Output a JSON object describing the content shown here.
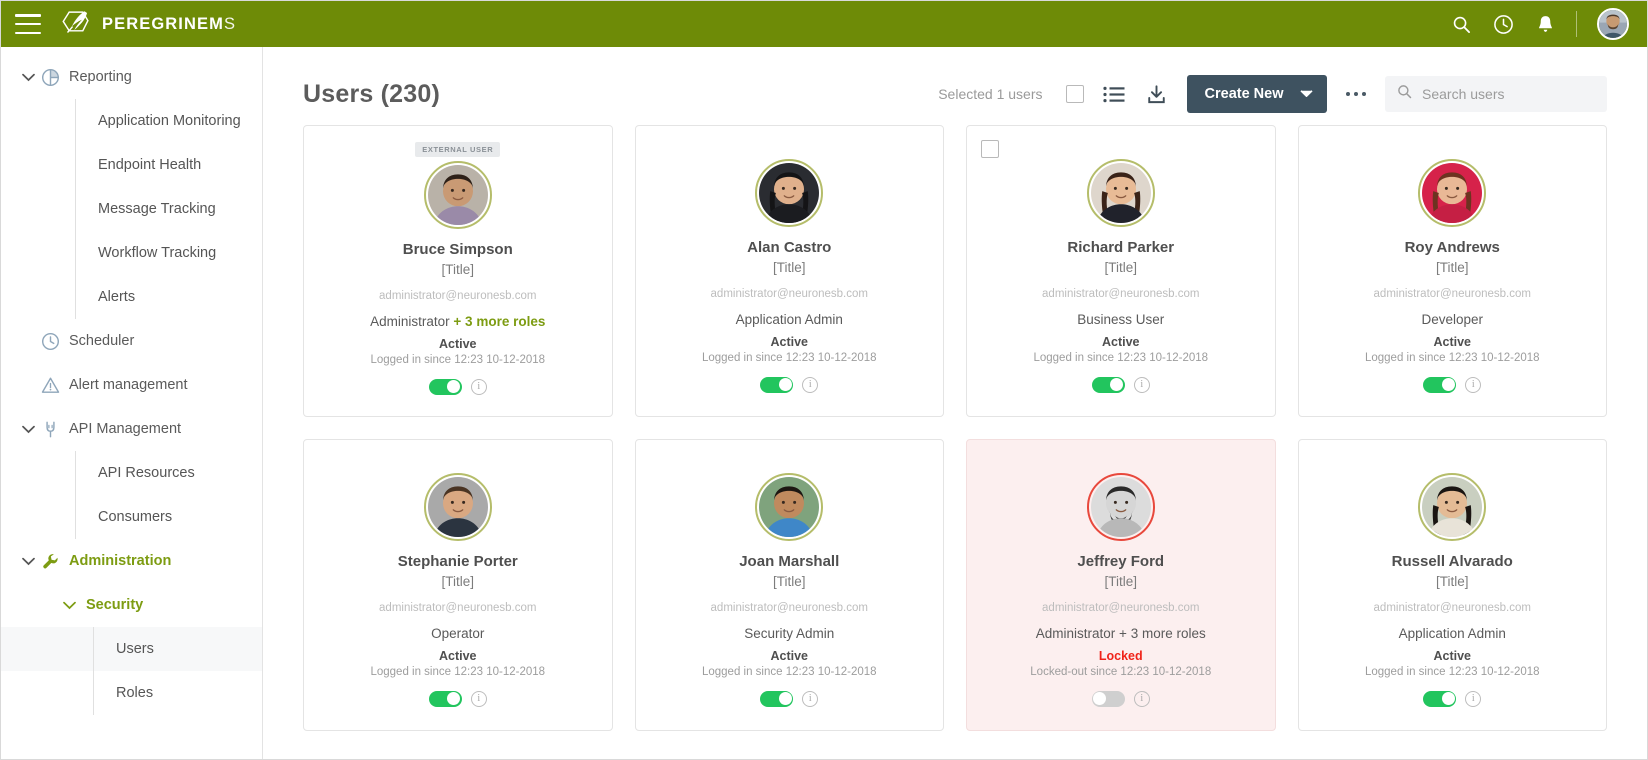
{
  "header": {
    "menu_icon": "hamburger-icon",
    "brand_bold": "PEREGRINEM",
    "brand_soft": "S",
    "icons": [
      "search-icon",
      "clock-icon",
      "bell-icon"
    ],
    "brand_color": "#6e8b07"
  },
  "sidebar": {
    "groups": [
      {
        "label": "Reporting",
        "icon": "pie-chart-icon",
        "expanded": true,
        "children": [
          "Application Monitoring",
          "Endpoint Health",
          "Message Tracking",
          "Workflow Tracking",
          "Alerts"
        ]
      },
      {
        "label": "Scheduler",
        "icon": "clock-icon",
        "expanded": false,
        "children": []
      },
      {
        "label": "Alert management",
        "icon": "warning-triangle-icon",
        "expanded": false,
        "children": []
      },
      {
        "label": "API Management",
        "icon": "plug-icon",
        "expanded": true,
        "children": [
          "API Resources",
          "Consumers"
        ]
      }
    ],
    "administration": {
      "label": "Administration",
      "icon": "wrench-icon",
      "accent_color": "#7d9c12",
      "security": {
        "label": "Security",
        "items": [
          {
            "label": "Users",
            "active": true
          },
          {
            "label": "Roles",
            "active": false
          }
        ]
      }
    }
  },
  "main": {
    "page_title": "Users (230)",
    "toolbar": {
      "selected_text": "Selected 1 users",
      "select_all_checkbox": "select-all-checkbox",
      "list_view_icon": "list-view-icon",
      "download_icon": "download-icon",
      "create_label": "Create New",
      "create_caret": "chevron-down-icon",
      "overflow_icon": "more-options-icon",
      "search_placeholder": "Search users",
      "search_value": "",
      "create_button_color": "#3e5260"
    },
    "users": [
      {
        "name": "Bruce Simpson",
        "title": "[Title]",
        "email": "administrator@neuronesb.com",
        "role_main": "Administrator",
        "role_more": "+ 3 more roles",
        "role_more_accent": true,
        "status": "Active",
        "since": "Logged in since 12:23 10-12-2018",
        "toggle_on": true,
        "badge": "EXTERNAL USER",
        "checkbox": false,
        "locked": false,
        "avatar": "male-1"
      },
      {
        "name": "Alan Castro",
        "title": "[Title]",
        "email": "administrator@neuronesb.com",
        "role_main": "Application Admin",
        "role_more": "",
        "role_more_accent": false,
        "status": "Active",
        "since": "Logged in since 12:23 10-12-2018",
        "toggle_on": true,
        "badge": "",
        "checkbox": false,
        "locked": false,
        "avatar": "female-1"
      },
      {
        "name": "Richard Parker",
        "title": "[Title]",
        "email": "administrator@neuronesb.com",
        "role_main": "Business User",
        "role_more": "",
        "role_more_accent": false,
        "status": "Active",
        "since": "Logged in since 12:23 10-12-2018",
        "toggle_on": true,
        "badge": "",
        "checkbox": true,
        "locked": false,
        "avatar": "female-2"
      },
      {
        "name": "Roy Andrews",
        "title": "[Title]",
        "email": "administrator@neuronesb.com",
        "role_main": "Developer",
        "role_more": "",
        "role_more_accent": false,
        "status": "Active",
        "since": "Logged in since 12:23 10-12-2018",
        "toggle_on": true,
        "badge": "",
        "checkbox": false,
        "locked": false,
        "avatar": "female-3"
      },
      {
        "name": "Stephanie Porter",
        "title": "[Title]",
        "email": "administrator@neuronesb.com",
        "role_main": "Operator",
        "role_more": "",
        "role_more_accent": false,
        "status": "Active",
        "since": "Logged in since 12:23 10-12-2018",
        "toggle_on": true,
        "badge": "",
        "checkbox": false,
        "locked": false,
        "avatar": "male-2"
      },
      {
        "name": "Joan Marshall",
        "title": "[Title]",
        "email": "administrator@neuronesb.com",
        "role_main": "Security Admin",
        "role_more": "",
        "role_more_accent": false,
        "status": "Active",
        "since": "Logged in since 12:23 10-12-2018",
        "toggle_on": true,
        "badge": "",
        "checkbox": false,
        "locked": false,
        "avatar": "male-3"
      },
      {
        "name": "Jeffrey Ford",
        "title": "[Title]",
        "email": "administrator@neuronesb.com",
        "role_main": "Administrator + 3 more roles",
        "role_more": "",
        "role_more_accent": false,
        "status": "Locked",
        "since": "Locked-out since 12:23 10-12-2018",
        "toggle_on": false,
        "badge": "",
        "checkbox": false,
        "locked": true,
        "avatar": "male-4"
      },
      {
        "name": "Russell Alvarado",
        "title": "[Title]",
        "email": "administrator@neuronesb.com",
        "role_main": "Application Admin",
        "role_more": "",
        "role_more_accent": false,
        "status": "Active",
        "since": "Logged in since 12:23 10-12-2018",
        "toggle_on": true,
        "badge": "",
        "checkbox": false,
        "locked": false,
        "avatar": "female-4"
      }
    ]
  }
}
